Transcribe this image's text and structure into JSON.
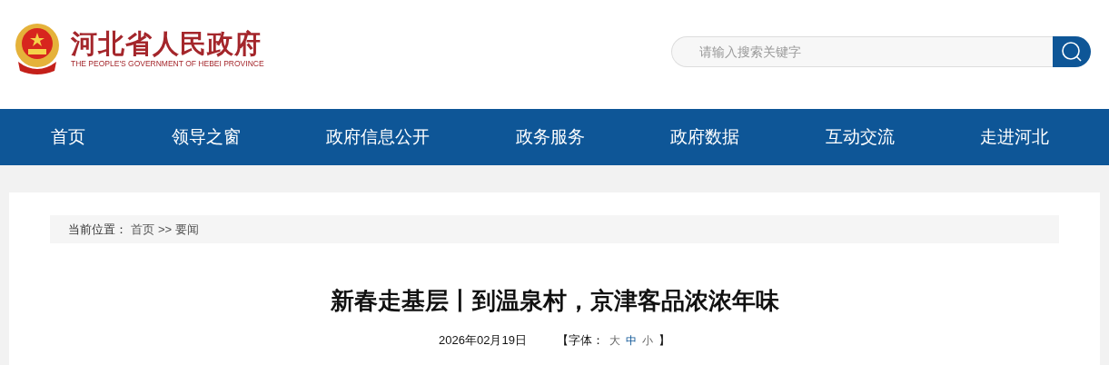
{
  "header": {
    "title": "河北省人民政府",
    "subtitle": "THE PEOPLE'S GOVERNMENT OF HEBEI PROVINCE",
    "search": {
      "placeholder": "请输入搜索关键字"
    }
  },
  "nav": [
    {
      "label": "首页"
    },
    {
      "label": "领导之窗"
    },
    {
      "label": "政府信息公开"
    },
    {
      "label": "政务服务"
    },
    {
      "label": "政府数据"
    },
    {
      "label": "互动交流"
    },
    {
      "label": "走进河北"
    }
  ],
  "breadcrumb": {
    "prefix": "当前位置：",
    "items": [
      "首页",
      ">>",
      "要闻"
    ]
  },
  "article": {
    "title": "新春走基层丨到温泉村，京津客品浓浓年味",
    "date": "2026年02月19日",
    "font_label": "【字体：",
    "font_sizes": [
      {
        "label": "大",
        "selected": false
      },
      {
        "label": "中",
        "selected": true
      },
      {
        "label": "小",
        "selected": false
      }
    ],
    "font_end": "】"
  }
}
